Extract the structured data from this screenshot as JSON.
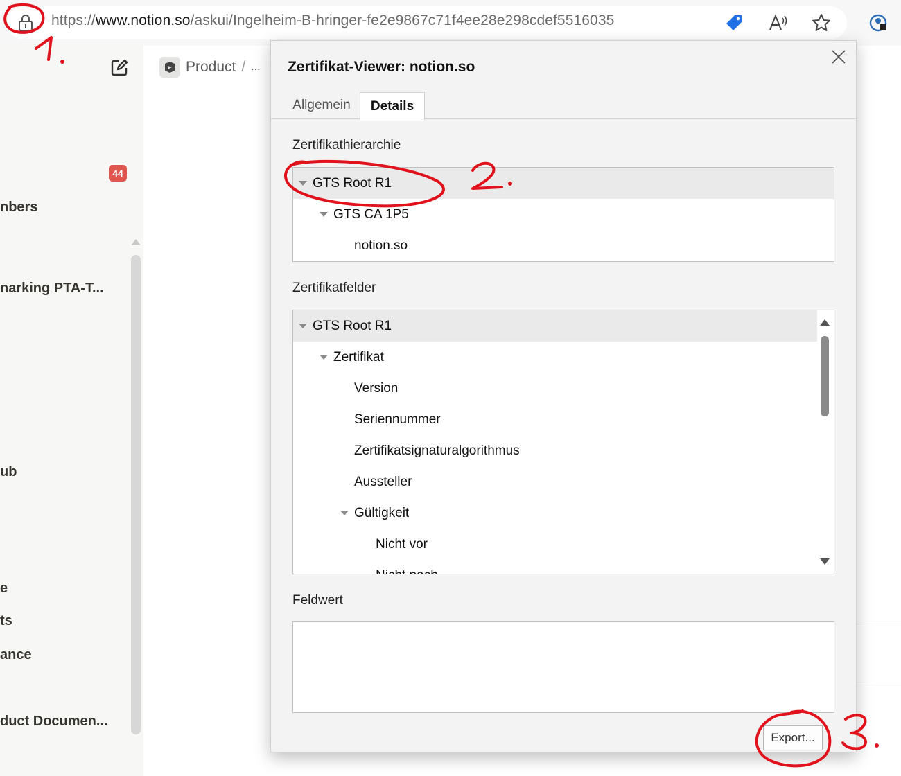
{
  "browser": {
    "url_prefix": "https://",
    "url_host": "www.notion.so",
    "url_path": "/askui/Ingelheim-B-hringer-fe2e9867c71f4ee28e298cdef5516035",
    "icons": [
      "lock-icon",
      "tag-icon",
      "read-aloud-icon",
      "favorite-star-icon",
      "profile-icon"
    ]
  },
  "sidebar": {
    "badge_count": "44",
    "items": [
      "nbers",
      "narking PTA-T...",
      "ub",
      "e",
      "ts",
      "ance",
      "duct Documen..."
    ]
  },
  "breadcrumb": {
    "product": "Product",
    "separator": "/",
    "ellipsis": "..."
  },
  "dialog": {
    "title": "Zertifikat-Viewer: notion.so",
    "tabs": [
      "Allgemein",
      "Details"
    ],
    "active_tab": "Details",
    "hierarchy_label": "Zertifikathierarchie",
    "hierarchy": [
      "GTS Root R1",
      "GTS CA 1P5",
      "notion.so"
    ],
    "fields_label": "Zertifikatfelder",
    "fields": [
      "GTS Root R1",
      "Zertifikat",
      "Version",
      "Seriennummer",
      "Zertifikatsignaturalgorithmus",
      "Aussteller",
      "Gültigkeit",
      "Nicht vor",
      "Nicht nach"
    ],
    "value_label": "Feldwert",
    "export_button": "Export..."
  },
  "annotations": [
    "1.",
    "2.",
    "3."
  ],
  "colors": {
    "annotation": "#e0131c",
    "badge": "#e0574f",
    "selected_row": "#eaeaea"
  }
}
